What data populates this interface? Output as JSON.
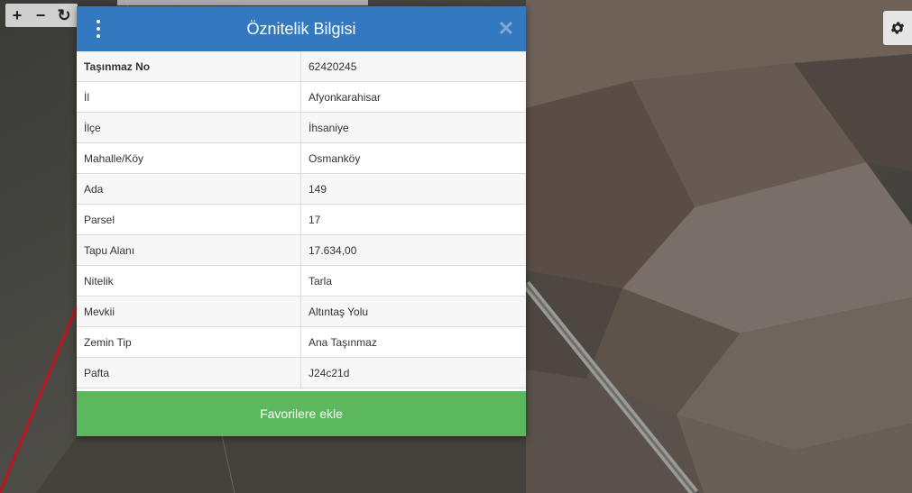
{
  "toolbar": {
    "zoom_in_label": "+",
    "zoom_out_label": "−",
    "refresh_label": "↻"
  },
  "settings": {
    "icon": "gear-icon"
  },
  "dialog": {
    "title": "Öznitelik Bilgisi",
    "menu_icon": "kebab-menu-icon",
    "close_label": "✕",
    "rows": [
      {
        "key": "Taşınmaz No",
        "value": "62420245"
      },
      {
        "key": "İl",
        "value": "Afyonkarahisar"
      },
      {
        "key": "İlçe",
        "value": "İhsaniye"
      },
      {
        "key": "Mahalle/Köy",
        "value": "Osmanköy"
      },
      {
        "key": "Ada",
        "value": "149"
      },
      {
        "key": "Parsel",
        "value": "17"
      },
      {
        "key": "Tapu Alanı",
        "value": "17.634,00"
      },
      {
        "key": "Nitelik",
        "value": "Tarla"
      },
      {
        "key": "Mevkii",
        "value": "Altıntaş Yolu"
      },
      {
        "key": "Zemin Tip",
        "value": "Ana Taşınmaz"
      },
      {
        "key": "Pafta",
        "value": "J24c21d"
      }
    ],
    "favorite_label": "Favorilere ekle"
  },
  "colors": {
    "header": "#3279bf",
    "favorite_button": "#5cb85c",
    "parcel_border": "#c0141e"
  }
}
